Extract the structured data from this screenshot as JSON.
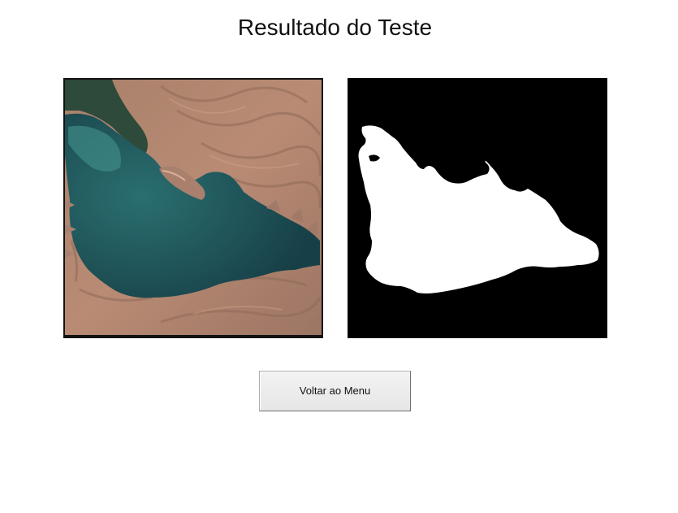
{
  "window": {
    "title": "Resultado do Teste"
  },
  "panels": {
    "original_image": "satellite-reservoir-image",
    "mask_image": "water-segmentation-mask"
  },
  "actions": {
    "back_label": "Voltar ao Menu"
  },
  "colors": {
    "background": "#ffffff",
    "water": "#1f4f55",
    "land": "#b0826c",
    "mask_fg": "#ffffff",
    "mask_bg": "#000000"
  }
}
